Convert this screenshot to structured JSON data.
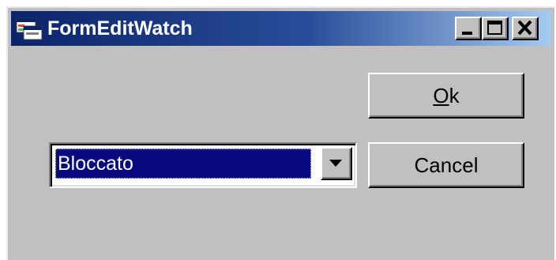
{
  "window": {
    "title": "FormEditWatch",
    "icons": {
      "app": "application-window-icon",
      "minimize": "minimize-icon",
      "maximize": "maximize-icon",
      "close": "close-icon"
    }
  },
  "buttons": {
    "ok_mnemonic": "O",
    "ok_rest": "k",
    "cancel_label": "Cancel"
  },
  "combo": {
    "selected_value": "Bloccato",
    "arrow_icon": "chevron-down-icon"
  },
  "colors": {
    "title_bar_start": "#0a246a",
    "title_bar_end": "#a6caf0",
    "face": "#c0c0c0",
    "selection": "#0a0a80"
  }
}
